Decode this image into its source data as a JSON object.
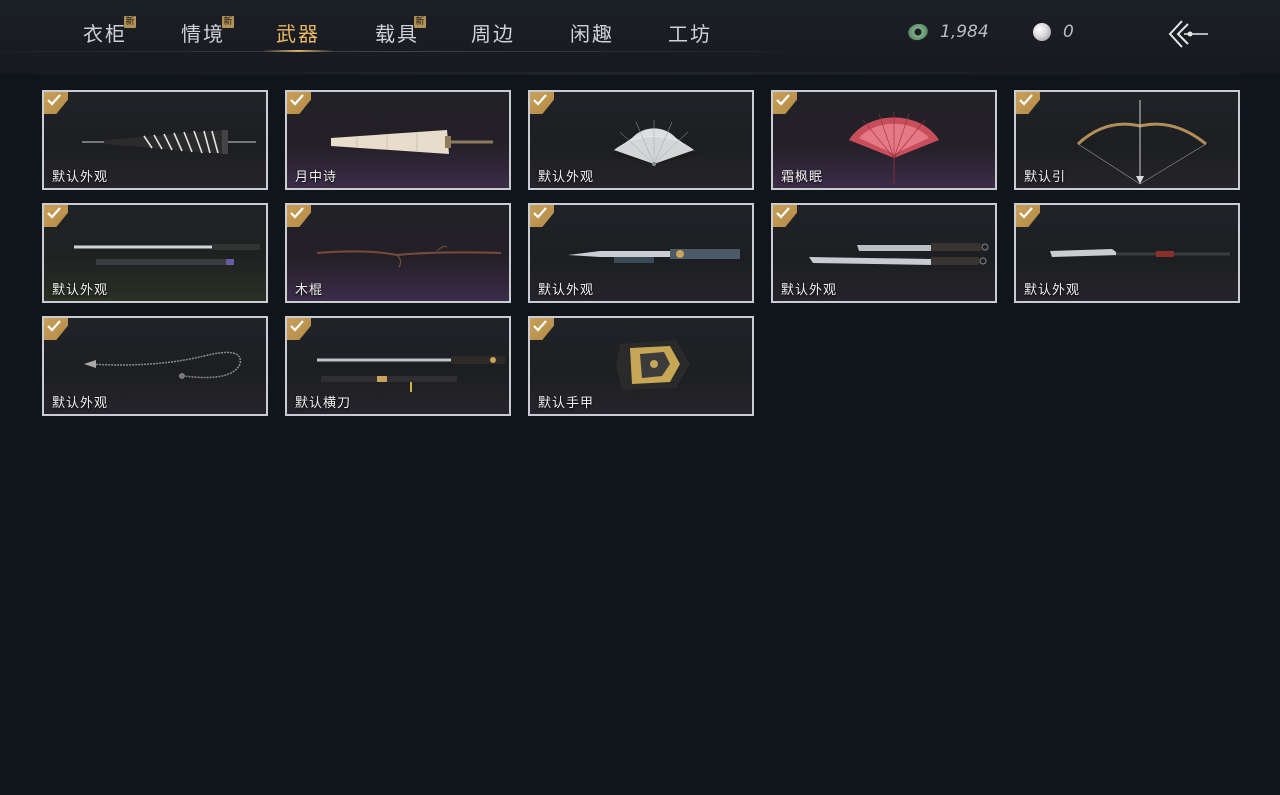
{
  "tabs": [
    {
      "label": "衣柜",
      "new": "新",
      "active": false
    },
    {
      "label": "情境",
      "new": "新",
      "active": false
    },
    {
      "label": "武器",
      "new": "",
      "active": true
    },
    {
      "label": "载具",
      "new": "新",
      "active": false
    },
    {
      "label": "周边",
      "new": "",
      "active": false
    },
    {
      "label": "闲趣",
      "new": "",
      "active": false
    },
    {
      "label": "工坊",
      "new": "",
      "active": false
    }
  ],
  "currency": {
    "jade": {
      "icon": "jade-coin-icon",
      "value": "1,984"
    },
    "pearl": {
      "icon": "pearl-icon",
      "value": "0"
    }
  },
  "back_icon": "back-arrow-icon",
  "items": [
    {
      "label": "默认外观",
      "art": "umbrella",
      "owned": true
    },
    {
      "label": "月中诗",
      "art": "parasol",
      "owned": true
    },
    {
      "label": "默认外观",
      "art": "fan-white",
      "owned": true
    },
    {
      "label": "霜枫眠",
      "art": "fan-red",
      "owned": true
    },
    {
      "label": "默认引",
      "art": "bow",
      "owned": true
    },
    {
      "label": "默认外观",
      "art": "dual-sword",
      "owned": true
    },
    {
      "label": "木棍",
      "art": "stick",
      "owned": true
    },
    {
      "label": "默认外观",
      "art": "dual-blade",
      "owned": true
    },
    {
      "label": "默认外观",
      "art": "twin-sabres",
      "owned": true
    },
    {
      "label": "默认外观",
      "art": "glaive",
      "owned": true
    },
    {
      "label": "默认外观",
      "art": "rope-dart",
      "owned": true
    },
    {
      "label": "默认横刀",
      "art": "hengdao",
      "owned": true
    },
    {
      "label": "默认手甲",
      "art": "gauntlet",
      "owned": true
    }
  ],
  "colors": {
    "active_tab": "#e9b867",
    "badge": "#b49253",
    "check": "#c9a25c",
    "background": "#10141b"
  }
}
